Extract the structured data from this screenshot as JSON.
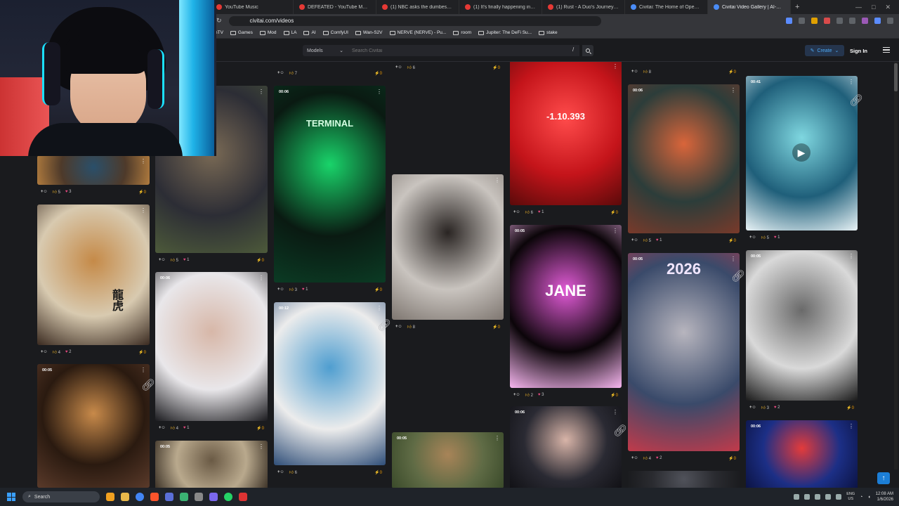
{
  "browser": {
    "tabs": [
      {
        "label": "YouTube Music",
        "fav": "red"
      },
      {
        "label": "DEFEATED - YouTube Music",
        "fav": "red"
      },
      {
        "label": "(1) NBC asks the dumbest questio",
        "fav": "red"
      },
      {
        "label": "(1) It's finally happening in Iran...",
        "fav": "red"
      },
      {
        "label": "(1) Rust - A Duo's Journey: The Ri",
        "fav": "red"
      },
      {
        "label": "Civitai: The Home of Open-Source",
        "fav": "blue"
      },
      {
        "label": "Civitai Video Gallery | AI-Gene",
        "fav": "blue"
      }
    ],
    "new_tab": "+",
    "url": "civitai.com/videos",
    "bookmarks": [
      "hTV",
      "Games",
      "Mod",
      "LA",
      "AI",
      "ComfyUI",
      "Wan-S2V",
      "NERVE (NERVE) - Pu...",
      "room",
      "Jupiter: The DeFi Su...",
      "stake"
    ],
    "window_controls": [
      "—",
      "□",
      "✕"
    ]
  },
  "site": {
    "models_label": "Models",
    "search_placeholder": "Search Civitai",
    "slash": "/",
    "create_label": "Create",
    "signin_label": "Sign In"
  },
  "cards": [
    {
      "name": "card-col1-top",
      "duration": "",
      "likes": "5",
      "hearts": "3",
      "buzz": "0",
      "colors": [
        "#4e3a2a",
        "#2a4f6a",
        "#b07b3e"
      ],
      "text": ""
    },
    {
      "name": "card-tiger-girl",
      "duration": "",
      "likes": "4",
      "hearts": "2",
      "buzz": "0",
      "colors": [
        "#d8cab0",
        "#c58a48",
        "#3a2a20"
      ],
      "text": "龍虎"
    },
    {
      "name": "card-fireworks-girl",
      "duration": "00:05",
      "likes": "",
      "hearts": "",
      "buzz": "",
      "colors": [
        "#2a1a10",
        "#c88a4a",
        "#5a3a2a"
      ],
      "text": ""
    },
    {
      "name": "card-tree-monster",
      "duration": "",
      "likes": "5",
      "hearts": "1",
      "buzz": "0",
      "colors": [
        "#2c2d35",
        "#7a6a55",
        "#4d5a3a"
      ],
      "text": ""
    },
    {
      "name": "card-asian-girl",
      "duration": "00:06",
      "likes": "4",
      "hearts": "1",
      "buzz": "0",
      "colors": [
        "#e9e7ea",
        "#d7b7a8",
        "#1b1b1f"
      ],
      "text": ""
    },
    {
      "name": "card-riders",
      "duration": "00:05",
      "likes": "",
      "hearts": "",
      "buzz": "",
      "colors": [
        "#b9a98d",
        "#6a5a45",
        "#3a3025"
      ],
      "text": ""
    },
    {
      "name": "card-terminal",
      "duration": "00:06",
      "likes": "3",
      "hearts": "1",
      "buzz": "0",
      "colors": [
        "#0a1a12",
        "#19d46a",
        "#0b3b24"
      ],
      "text": "TERMINAL"
    },
    {
      "name": "card-fat-man",
      "duration": "00:12",
      "likes": "6",
      "hearts": "",
      "buzz": "0",
      "colors": [
        "#ececec",
        "#4f9ed0",
        "#2f4e78"
      ],
      "text": ""
    },
    {
      "name": "card-col3-top",
      "duration": "",
      "likes": "6",
      "hearts": "",
      "buzz": "0",
      "colors": [
        "#1a1b1e",
        "#1a1b1e",
        "#1a1b1e"
      ],
      "text": ""
    },
    {
      "name": "card-fur-coat",
      "duration": "",
      "likes": "8",
      "hearts": "",
      "buzz": "0",
      "colors": [
        "#c9c4bf",
        "#2a2523",
        "#7e7670"
      ],
      "text": ""
    },
    {
      "name": "card-cat",
      "duration": "00:05",
      "likes": "",
      "hearts": "",
      "buzz": "",
      "colors": [
        "#5f6b45",
        "#a88458",
        "#3a4a2a"
      ],
      "text": ""
    },
    {
      "name": "card-red-eye",
      "duration": "",
      "likes": "6",
      "hearts": "1",
      "buzz": "0",
      "colors": [
        "#c4141a",
        "#ff4b4b",
        "#5a0a0a"
      ],
      "text": "-1.10.393"
    },
    {
      "name": "card-flower",
      "duration": "00:05",
      "likes": "2",
      "hearts": "3",
      "buzz": "0",
      "colors": [
        "#0b0509",
        "#e15ad6",
        "#f7b6f0"
      ],
      "text": "JANE"
    },
    {
      "name": "card-anime-woman",
      "duration": "00:06",
      "likes": "",
      "hearts": "",
      "buzz": "",
      "colors": [
        "#2a2a33",
        "#d8b4a8",
        "#101014"
      ],
      "text": ""
    },
    {
      "name": "card-col5-top",
      "duration": "",
      "likes": "8",
      "hearts": "",
      "buzz": "0",
      "colors": [
        "#1a1b1e",
        "#1a1b1e",
        "#1a1b1e"
      ],
      "text": ""
    },
    {
      "name": "card-robot-girl",
      "duration": "00:06",
      "likes": "5",
      "hearts": "1",
      "buzz": "0",
      "colors": [
        "#2c3d3a",
        "#d9653a",
        "#7a3a2a"
      ],
      "text": ""
    },
    {
      "name": "card-2026-girl",
      "duration": "00:05",
      "likes": "4",
      "hearts": "2",
      "buzz": "0",
      "colors": [
        "#3a4a6a",
        "#b7b5be",
        "#c23a4a"
      ],
      "text": "2026"
    },
    {
      "name": "card-col5-bottom",
      "duration": "",
      "likes": "",
      "hearts": "",
      "buzz": "",
      "colors": [
        "#2a2b30",
        "#50525a",
        "#1a1b1e"
      ],
      "text": ""
    },
    {
      "name": "card-umbrella-girl",
      "duration": "00:41",
      "likes": "5",
      "hearts": "1",
      "buzz": "",
      "colors": [
        "#1f5f7a",
        "#7fd7e0",
        "#e9f3f6"
      ],
      "text": ""
    },
    {
      "name": "card-sketch-house",
      "duration": "00:05",
      "likes": "3",
      "hearts": "2",
      "buzz": "0",
      "colors": [
        "#d9d9d9",
        "#6a6a6a",
        "#1a1a1a"
      ],
      "text": ""
    },
    {
      "name": "card-abstract",
      "duration": "00:06",
      "likes": "",
      "hearts": "",
      "buzz": "",
      "colors": [
        "#1c2f86",
        "#e33b3b",
        "#0b1240"
      ],
      "text": ""
    }
  ],
  "top_row_stats": [
    {
      "name": "stat-col2-top",
      "likes": "7",
      "buzz": "0"
    },
    {
      "name": "stat-col1-mid",
      "likes": "",
      "buzz": "0"
    }
  ],
  "taskbar": {
    "search_label": "Search",
    "time": "12:08 AM",
    "date": "1/6/2026",
    "lang_line1": "ENG",
    "lang_line2": "US"
  },
  "scroll_top": "↑"
}
